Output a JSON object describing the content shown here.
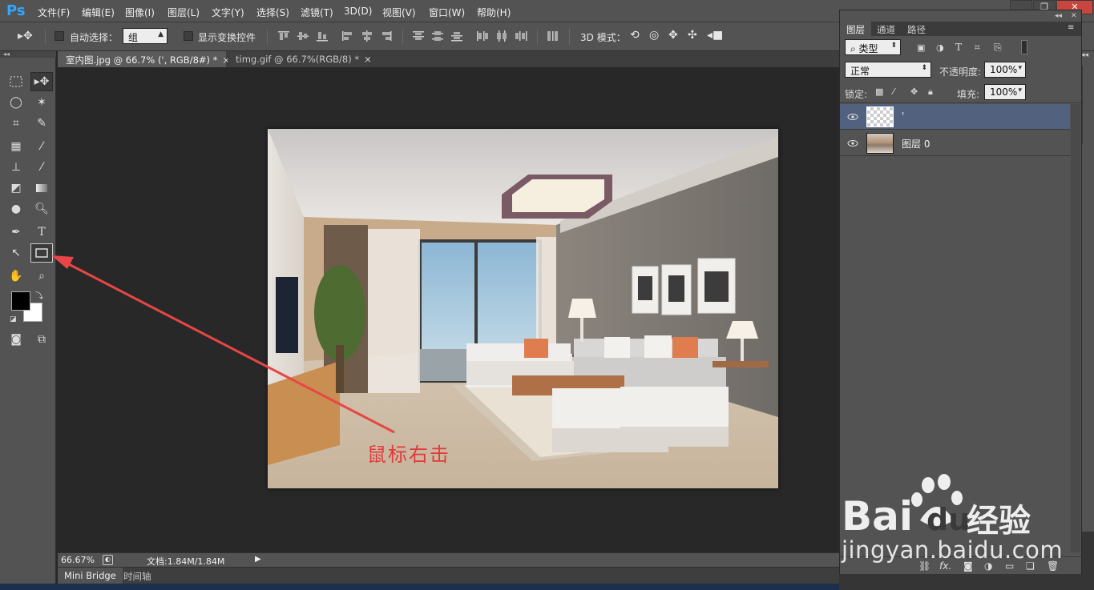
{
  "app": {
    "logo": "Ps"
  },
  "menu": [
    "文件(F)",
    "编辑(E)",
    "图像(I)",
    "图层(L)",
    "文字(Y)",
    "选择(S)",
    "滤镜(T)",
    "3D(D)",
    "视图(V)",
    "窗口(W)",
    "帮助(H)"
  ],
  "options": {
    "auto_select_label": "自动选择：",
    "auto_select_value": "组",
    "show_transform_label": "显示变换控件",
    "mode_3d_label": "3D 模式："
  },
  "tabs": [
    {
      "label": "室内图.jpg @ 66.7% (', RGB/8#) *",
      "close": "×"
    },
    {
      "label": "timg.gif @ 66.7%(RGB/8) *",
      "close": "×"
    }
  ],
  "status": {
    "zoom": "66.67%",
    "doc": "文档:1.84M/1.84M"
  },
  "bottom_tabs": [
    "Mini Bridge",
    "时间轴"
  ],
  "layers_panel": {
    "tabs": [
      "图层",
      "通道",
      "路径"
    ],
    "filter_label": "类型",
    "blend_mode": "正常",
    "opacity_label": "不透明度:",
    "opacity_value": "100%",
    "lock_label": "锁定:",
    "fill_label": "填充:",
    "fill_value": "100%",
    "layers": [
      {
        "name": "'",
        "selected": true,
        "thumb": "transparent"
      },
      {
        "name": "图层 0",
        "selected": false,
        "thumb": "photo"
      }
    ],
    "bottom_icons": [
      "link-icon",
      "fx-icon",
      "mask-icon",
      "adjustment-icon",
      "folder-icon",
      "new-layer-icon",
      "trash-icon"
    ],
    "fx_label": "fx."
  },
  "annotation": {
    "text": "鼠标右击",
    "color": "#e03a3a"
  },
  "watermark": {
    "brand_text": "Bai du 经验",
    "url": "jingyan.baidu.com"
  }
}
